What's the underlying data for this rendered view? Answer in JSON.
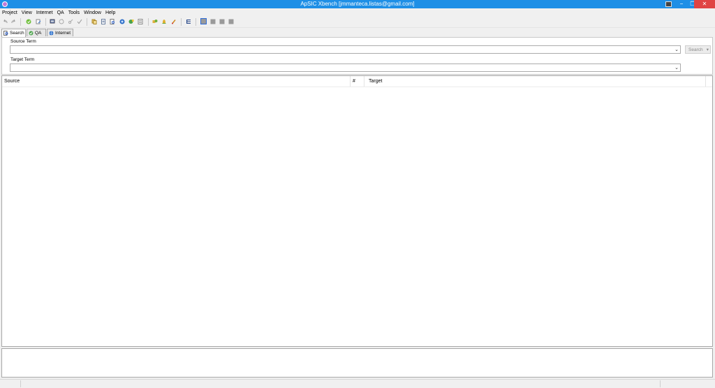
{
  "window": {
    "title": "ApSIC Xbench [jmmanteca.listas@gmail.com]",
    "controls": [
      "−",
      "❐",
      "✕"
    ]
  },
  "menu": [
    "Project",
    "View",
    "Internet",
    "QA",
    "Tools",
    "Window",
    "Help"
  ],
  "tabs": [
    {
      "label": "Search",
      "icon": "search-icon",
      "active": true
    },
    {
      "label": "QA",
      "icon": "qa-icon",
      "active": false
    },
    {
      "label": "Internet",
      "icon": "globe-icon",
      "active": false
    }
  ],
  "search": {
    "source_label": "Source Term",
    "source_value": "",
    "target_label": "Target Term",
    "target_value": "",
    "button_label": "Search",
    "dropdown_glyph": "⌄"
  },
  "results": {
    "columns": [
      "Source",
      "#",
      "Target"
    ],
    "rows": []
  }
}
